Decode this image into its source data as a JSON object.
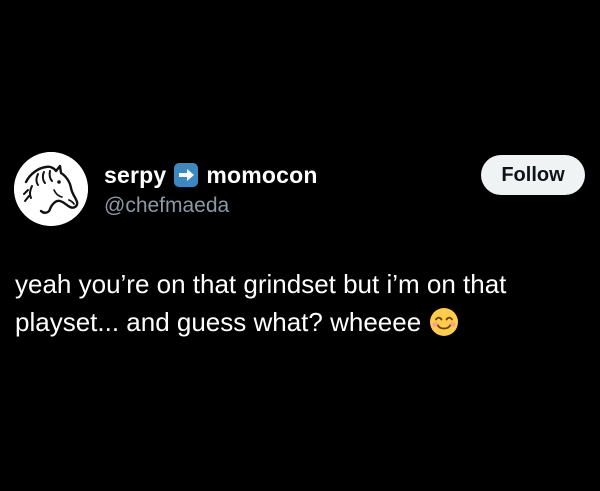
{
  "post": {
    "author": {
      "display_name_part1": "serpy",
      "display_name_part2": "momocon",
      "name_icon": "right-arrow-emoji-icon",
      "handle": "@chefmaeda",
      "avatar_icon": "horse-drawing-avatar"
    },
    "follow_label": "Follow",
    "text_line1": "yeah you’re on that grindset but i’m on that",
    "text_line2": "playset... and guess what? wheeee",
    "text_emoji": "smiling-face-emoji-icon"
  },
  "colors": {
    "background": "#000000",
    "text": "#ffffff",
    "handle": "#8b98a5",
    "button_bg": "#eff3f4",
    "button_text": "#0f1419",
    "arrow_emoji_bg": "#3b88c3",
    "smile_emoji": "#ffcc4d"
  }
}
